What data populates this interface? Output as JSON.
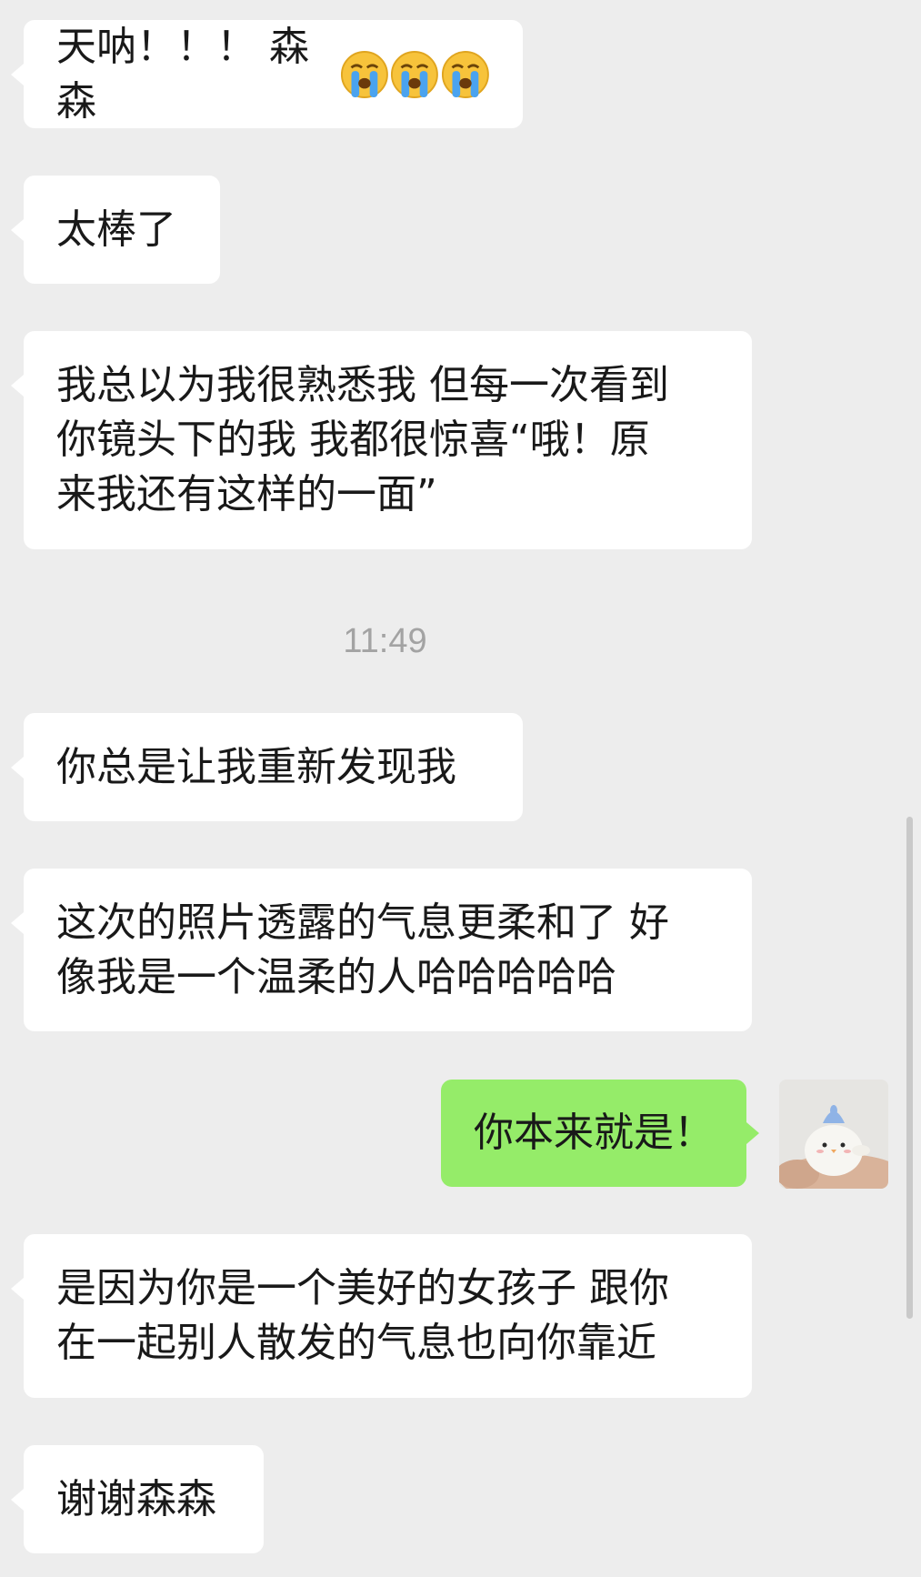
{
  "messages": [
    {
      "id": "m1",
      "direction": "incoming",
      "text": "天呐！！！ 森森",
      "emoji": [
        "loudly-crying-face",
        "loudly-crying-face",
        "loudly-crying-face"
      ]
    },
    {
      "id": "m2",
      "direction": "incoming",
      "text": "太棒了"
    },
    {
      "id": "m3",
      "direction": "incoming",
      "text": "我总以为我很熟悉我 但每一次看到\n你镜头下的我 我都很惊喜“哦！原\n来我还有这样的一面”"
    },
    {
      "id": "m4",
      "direction": "incoming",
      "text": "你总是让我重新发现我"
    },
    {
      "id": "m5",
      "direction": "incoming",
      "text": "这次的照片透露的气息更柔和了 好\n像我是一个温柔的人哈哈哈哈哈"
    },
    {
      "id": "m6",
      "direction": "outgoing",
      "text": "你本来就是！"
    },
    {
      "id": "m7",
      "direction": "incoming",
      "text": "是因为你是一个美好的女孩子 跟你\n在一起别人散发的气息也向你靠近"
    },
    {
      "id": "m8",
      "direction": "incoming",
      "text": "谢谢森森"
    }
  ],
  "timestamp": "11:49",
  "colors": {
    "background": "#ededed",
    "incoming_bubble": "#ffffff",
    "outgoing_bubble": "#95ec69",
    "text": "#191919",
    "timestamp": "#a3a3a3"
  },
  "avatar": {
    "icon": "plush-toy-avatar"
  }
}
